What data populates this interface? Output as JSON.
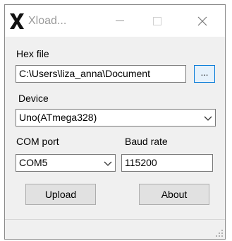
{
  "window": {
    "title": "Xload...",
    "icon": "xload-x-icon",
    "controls": [
      "minimize-icon",
      "maximize-icon",
      "close-icon"
    ]
  },
  "form": {
    "hex_file_label": "Hex file",
    "hex_file_value": "C:\\Users\\liza_anna\\Document",
    "browse_label": "...",
    "device_label": "Device",
    "device_selected": "Uno(ATmega328)",
    "com_port_label": "COM port",
    "com_port_selected": "COM5",
    "baud_rate_label": "Baud rate",
    "baud_rate_value": "115200",
    "upload_label": "Upload",
    "about_label": "About"
  },
  "colors": {
    "title_text": "#9a9a9a",
    "accent_border": "#0078d7",
    "window_bg": "#f0f0f0"
  }
}
